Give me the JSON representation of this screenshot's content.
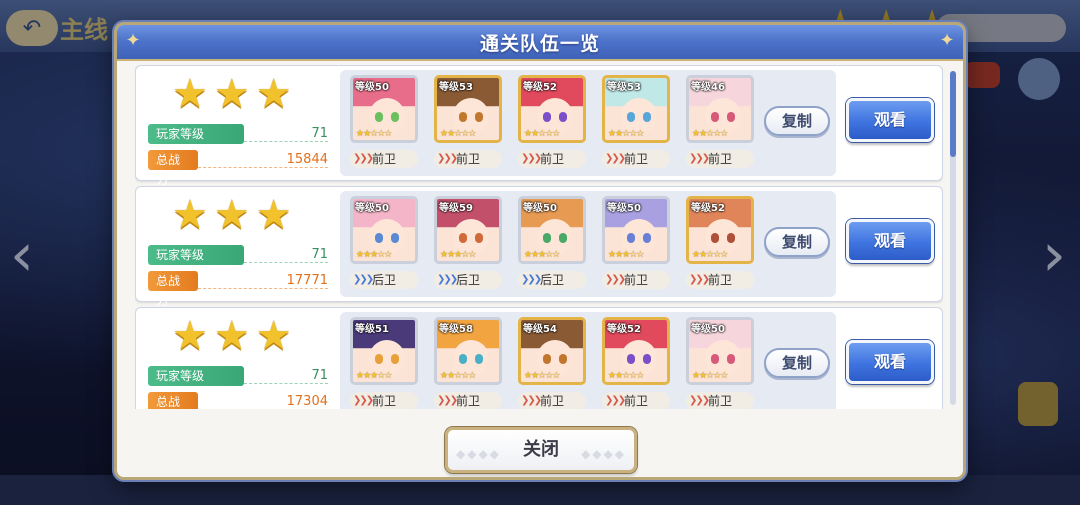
{
  "dialog": {
    "title": "通关队伍一览",
    "close_label": "关闭"
  },
  "labels": {
    "player_level": "玩家等级",
    "total_power": "总战力",
    "copy": "复制",
    "watch": "观看"
  },
  "background": {
    "back_icon": "back-arrow-icon",
    "title_fragment": "主线"
  },
  "teams": [
    {
      "stars": 3,
      "player_level": "71",
      "total_power": "15844",
      "units": [
        {
          "level": "等级50",
          "role": "前卫",
          "frame": "silver",
          "unit_stars": 2,
          "hair": "#e86d8a",
          "eyes": "#6bbf5e"
        },
        {
          "level": "等级53",
          "role": "前卫",
          "frame": "gold",
          "unit_stars": 2,
          "hair": "#8a5a34",
          "eyes": "#c2772e"
        },
        {
          "level": "等级52",
          "role": "前卫",
          "frame": "gold",
          "unit_stars": 2,
          "hair": "#e04a5c",
          "eyes": "#7a4fc8"
        },
        {
          "level": "等级53",
          "role": "前卫",
          "frame": "gold",
          "unit_stars": 2,
          "hair": "#bfe8e6",
          "eyes": "#5aa6d8"
        },
        {
          "level": "等级46",
          "role": "前卫",
          "frame": "silver",
          "unit_stars": 2,
          "hair": "#f6d6dc",
          "eyes": "#d85a7a"
        }
      ]
    },
    {
      "stars": 3,
      "player_level": "71",
      "total_power": "17771",
      "units": [
        {
          "level": "等级50",
          "role": "后卫",
          "frame": "silver",
          "unit_stars": 3,
          "hair": "#f5b5c9",
          "eyes": "#5a8ad6"
        },
        {
          "level": "等级59",
          "role": "后卫",
          "frame": "silver",
          "unit_stars": 3,
          "hair": "#c2506a",
          "eyes": "#d06a3a"
        },
        {
          "level": "等级50",
          "role": "后卫",
          "frame": "silver",
          "unit_stars": 3,
          "hair": "#e79a52",
          "eyes": "#4aa868"
        },
        {
          "level": "等级50",
          "role": "前卫",
          "frame": "silver",
          "unit_stars": 3,
          "hair": "#a8a0e0",
          "eyes": "#6a80d8"
        },
        {
          "level": "等级52",
          "role": "前卫",
          "frame": "gold",
          "unit_stars": 2,
          "hair": "#e0855a",
          "eyes": "#b0503a"
        }
      ]
    },
    {
      "stars": 3,
      "player_level": "71",
      "total_power": "17304",
      "units": [
        {
          "level": "等级51",
          "role": "前卫",
          "frame": "silver",
          "unit_stars": 3,
          "hair": "#4a3a7a",
          "eyes": "#e8a03a"
        },
        {
          "level": "等级58",
          "role": "前卫",
          "frame": "silver",
          "unit_stars": 2,
          "hair": "#f2a440",
          "eyes": "#4ab0c8"
        },
        {
          "level": "等级54",
          "role": "前卫",
          "frame": "gold",
          "unit_stars": 2,
          "hair": "#8a5a34",
          "eyes": "#c2772e"
        },
        {
          "level": "等级52",
          "role": "前卫",
          "frame": "gold",
          "unit_stars": 2,
          "hair": "#e04a5c",
          "eyes": "#7a4fc8"
        },
        {
          "level": "等级50",
          "role": "前卫",
          "frame": "silver",
          "unit_stars": 2,
          "hair": "#f6d6dc",
          "eyes": "#d85a7a"
        }
      ]
    }
  ],
  "colors": {
    "header_blue": "#4b71c9",
    "watch_blue": "#3f74e0",
    "gold_frame": "#e3b548",
    "green_tag": "#3aa876",
    "orange_tag": "#e47b1f"
  }
}
